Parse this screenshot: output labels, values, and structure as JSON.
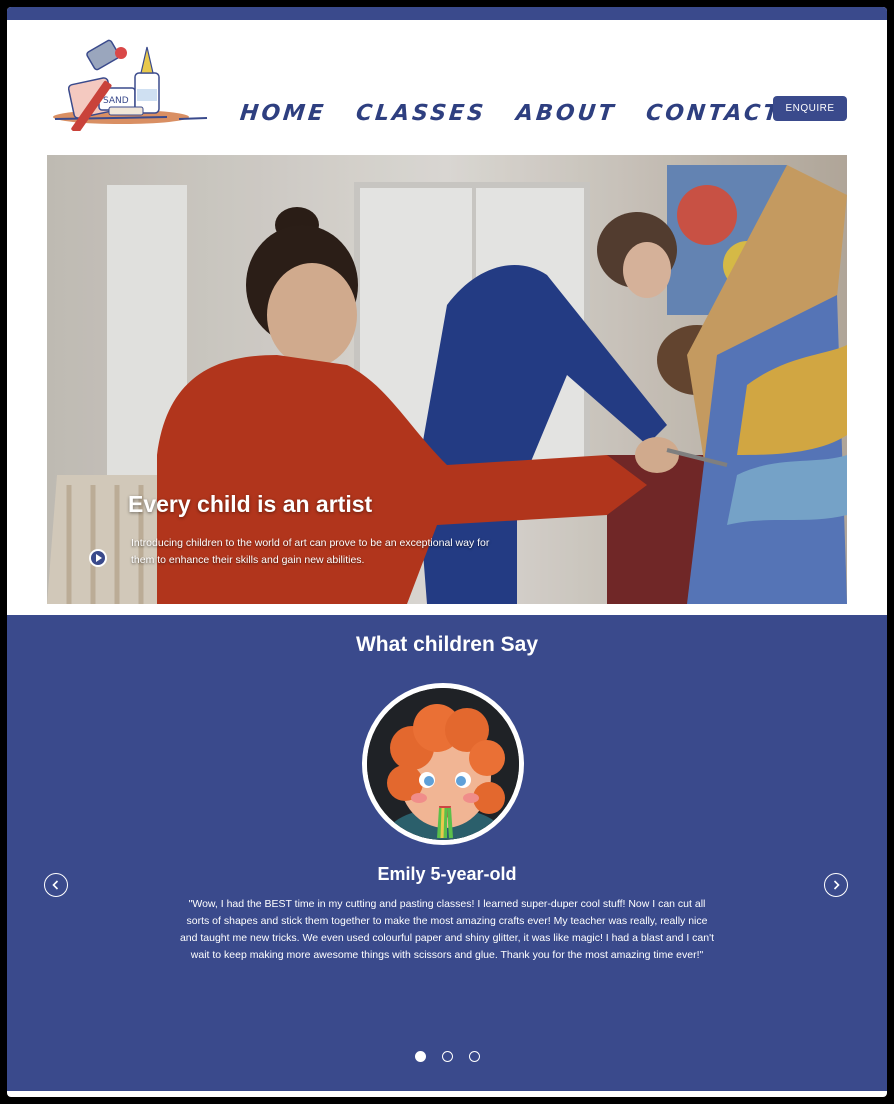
{
  "nav": {
    "items": [
      "HOME",
      "CLASSES",
      "ABOUT",
      "CONTACT"
    ],
    "enquire_label": "ENQUIRE"
  },
  "hero": {
    "title": "Every child is an artist",
    "description": "Introducing children to the world of art can prove to be an exceptional way for them to enhance their skills and gain new abilities."
  },
  "testimonials": {
    "title": "What children Say",
    "name": "Emily 5-year-old",
    "quote": "\"Wow, I had the BEST time in my cutting and pasting classes! I learned super-duper cool stuff! Now I can cut all sorts of shapes and stick them together to make the most amazing crafts ever! My teacher was really, really nice and taught me new tricks. We even used colourful paper and shiny glitter, it was like magic! I had a blast and I can't wait to keep making more awesome things with scissors and glue. Thank you for the most amazing time ever!\"",
    "slides_total": 3,
    "active_slide": 1
  },
  "colors": {
    "brand": "#3a4a8c",
    "nav_text": "#2e3f80",
    "white": "#ffffff"
  }
}
